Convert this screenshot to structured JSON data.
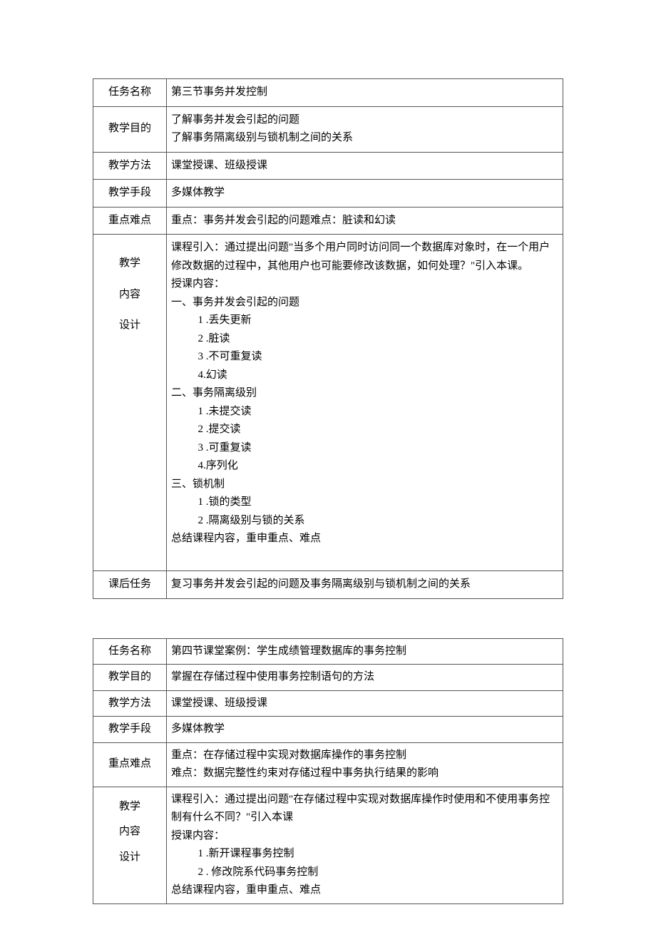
{
  "table1": {
    "labels": {
      "task_name": "任务名称",
      "objective": "教学目的",
      "method": "教学方法",
      "means": "教学手段",
      "keypoints": "重点难点",
      "design": "教学",
      "design2": "内容",
      "design3": "设计",
      "after": "课后任务"
    },
    "task_name": "第三节事务并发控制",
    "objective_l1": "了解事务并发会引起的问题",
    "objective_l2": "了解事务隔离级别与锁机制之间的关系",
    "method": "课堂授课、班级授课",
    "means": "多媒体教学",
    "keypoints": "重点：事务并发会引起的问题难点：脏读和幻读",
    "content": {
      "intro": "课程引入：通过提出问题\"当多个用户同时访问同一个数据库对象时，在一个用户修改数据的过程中，其他用户也可能要修改该数据，如何处理？\"引入本课。",
      "section_h": "授课内容：",
      "s1_h": "一、事务并发会引起的问题",
      "s1_1": "1 .丢失更新",
      "s1_2": "2 .脏读",
      "s1_3": "3 .不可重复读",
      "s1_4": "4.幻读",
      "s2_h": "二、事务隔离级别",
      "s2_1": "1 .未提交读",
      "s2_2": "2 .提交读",
      "s2_3": "3 .可重复读",
      "s2_4": "4.序列化",
      "s3_h": "三、锁机制",
      "s3_1": "1 .锁的类型",
      "s3_2": "2 .隔离级别与锁的关系",
      "summary": "总结课程内容，重申重点、难点"
    },
    "after": "复习事务并发会引起的问题及事务隔离级别与锁机制之间的关系"
  },
  "table2": {
    "labels": {
      "task_name": "任务名称",
      "objective": "教学目的",
      "method": "教学方法",
      "means": "教学手段",
      "keypoints": "重点难点",
      "design": "教学",
      "design2": "内容",
      "design3": "设计"
    },
    "task_name": "第四节课堂案例：学生成绩管理数据库的事务控制",
    "objective": "掌握在存储过程中使用事务控制语句的方法",
    "method": "课堂授课、班级授课",
    "means": "多媒体教学",
    "keypoints_l1": "重点：在存储过程中实现对数据库操作的事务控制",
    "keypoints_l2": "难点：数据完整性约束对存储过程中事务执行结果的影响",
    "content": {
      "intro": "课程引入：通过提出问题\"在存储过程中实现对数据库操作时使用和不使用事务控制有什么不同？\"引入本课",
      "section_h": "授课内容：",
      "s1_1": "1 .新开课程事务控制",
      "s1_2": "2 . 修改院系代码事务控制",
      "summary": "总结课程内容，重申重点、难点"
    }
  }
}
